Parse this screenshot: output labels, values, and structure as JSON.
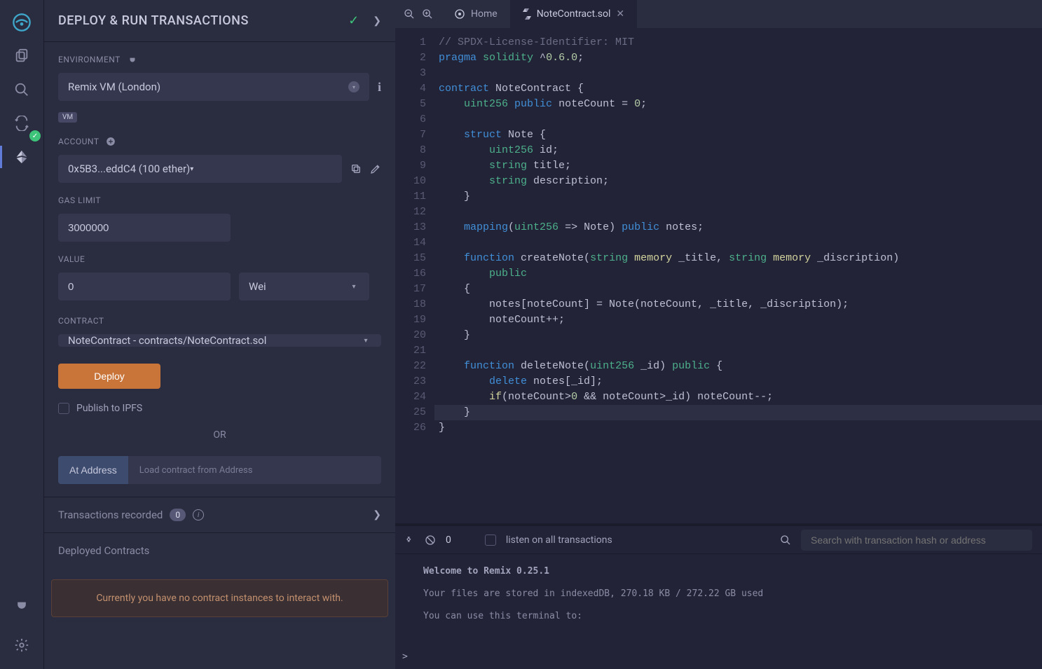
{
  "iconbar": {
    "items": [
      "logo",
      "files",
      "search",
      "compiler",
      "deploy",
      "plugin",
      "settings"
    ]
  },
  "panel": {
    "title": "DEPLOY & RUN TRANSACTIONS",
    "env_label": "ENVIRONMENT",
    "env_value": "Remix VM (London)",
    "env_badge": "VM",
    "account_label": "ACCOUNT",
    "account_value": "0x5B3...eddC4 (100 ether)",
    "gas_label": "GAS LIMIT",
    "gas_value": "3000000",
    "value_label": "VALUE",
    "value_value": "0",
    "value_unit": "Wei",
    "contract_label": "CONTRACT",
    "contract_value": "NoteContract - contracts/NoteContract.sol",
    "deploy_btn": "Deploy",
    "publish_ipfs": "Publish to IPFS",
    "or_text": "OR",
    "ataddress_btn": "At Address",
    "ataddress_ph": "Load contract from Address",
    "txrec_title": "Transactions recorded",
    "txrec_count": "0",
    "deployed_title": "Deployed Contracts",
    "no_contract_msg": "Currently you have no contract instances to interact with."
  },
  "tabs": {
    "home": "Home",
    "file": "NoteContract.sol"
  },
  "editor": {
    "lines": [
      {
        "n": 1,
        "segs": [
          {
            "t": "// SPDX-License-Identifier: MIT",
            "c": "tok-comment"
          }
        ]
      },
      {
        "n": 2,
        "segs": [
          {
            "t": "pragma",
            "c": "tok-keyword"
          },
          {
            "t": " "
          },
          {
            "t": "solidity",
            "c": "tok-keyword2"
          },
          {
            "t": " ^"
          },
          {
            "t": "0.6.0",
            "c": "tok-num"
          },
          {
            "t": ";"
          }
        ]
      },
      {
        "n": 3,
        "segs": [
          {
            "t": ""
          }
        ]
      },
      {
        "n": 4,
        "segs": [
          {
            "t": "contract",
            "c": "tok-keyword"
          },
          {
            "t": " NoteContract {"
          }
        ]
      },
      {
        "n": 5,
        "segs": [
          {
            "t": "    "
          },
          {
            "t": "uint256",
            "c": "tok-type"
          },
          {
            "t": " "
          },
          {
            "t": "public",
            "c": "tok-keyword"
          },
          {
            "t": " noteCount = "
          },
          {
            "t": "0",
            "c": "tok-num"
          },
          {
            "t": ";"
          }
        ]
      },
      {
        "n": 6,
        "segs": [
          {
            "t": ""
          }
        ]
      },
      {
        "n": 7,
        "segs": [
          {
            "t": "    "
          },
          {
            "t": "struct",
            "c": "tok-keyword"
          },
          {
            "t": " Note {"
          }
        ]
      },
      {
        "n": 8,
        "segs": [
          {
            "t": "        "
          },
          {
            "t": "uint256",
            "c": "tok-type"
          },
          {
            "t": " id;"
          }
        ]
      },
      {
        "n": 9,
        "segs": [
          {
            "t": "        "
          },
          {
            "t": "string",
            "c": "tok-type"
          },
          {
            "t": " title;"
          }
        ]
      },
      {
        "n": 10,
        "segs": [
          {
            "t": "        "
          },
          {
            "t": "string",
            "c": "tok-type"
          },
          {
            "t": " description;"
          }
        ]
      },
      {
        "n": 11,
        "segs": [
          {
            "t": "    }"
          }
        ]
      },
      {
        "n": 12,
        "segs": [
          {
            "t": ""
          }
        ]
      },
      {
        "n": 13,
        "segs": [
          {
            "t": "    "
          },
          {
            "t": "mapping",
            "c": "tok-keyword"
          },
          {
            "t": "("
          },
          {
            "t": "uint256",
            "c": "tok-type"
          },
          {
            "t": " => Note) "
          },
          {
            "t": "public",
            "c": "tok-keyword"
          },
          {
            "t": " notes;"
          }
        ]
      },
      {
        "n": 14,
        "segs": [
          {
            "t": ""
          }
        ]
      },
      {
        "n": 15,
        "segs": [
          {
            "t": "    "
          },
          {
            "t": "function",
            "c": "tok-keyword"
          },
          {
            "t": " createNote("
          },
          {
            "t": "string",
            "c": "tok-type"
          },
          {
            "t": " "
          },
          {
            "t": "memory",
            "c": "tok-op"
          },
          {
            "t": " _title, "
          },
          {
            "t": "string",
            "c": "tok-type"
          },
          {
            "t": " "
          },
          {
            "t": "memory",
            "c": "tok-op"
          },
          {
            "t": " _discription)"
          }
        ]
      },
      {
        "n": 16,
        "segs": [
          {
            "t": "        "
          },
          {
            "t": "public",
            "c": "tok-keyword2"
          }
        ]
      },
      {
        "n": 17,
        "segs": [
          {
            "t": "    {"
          }
        ]
      },
      {
        "n": 18,
        "segs": [
          {
            "t": "        notes[noteCount] = Note(noteCount, _title, _discription);"
          }
        ]
      },
      {
        "n": 19,
        "segs": [
          {
            "t": "        noteCount++;"
          }
        ]
      },
      {
        "n": 20,
        "segs": [
          {
            "t": "    }"
          }
        ]
      },
      {
        "n": 21,
        "segs": [
          {
            "t": ""
          }
        ]
      },
      {
        "n": 22,
        "segs": [
          {
            "t": "    "
          },
          {
            "t": "function",
            "c": "tok-keyword"
          },
          {
            "t": " deleteNote("
          },
          {
            "t": "uint256",
            "c": "tok-type"
          },
          {
            "t": " _id) "
          },
          {
            "t": "public",
            "c": "tok-keyword2"
          },
          {
            "t": " {"
          }
        ]
      },
      {
        "n": 23,
        "segs": [
          {
            "t": "        "
          },
          {
            "t": "delete",
            "c": "tok-keyword"
          },
          {
            "t": " notes[_id];"
          }
        ]
      },
      {
        "n": 24,
        "segs": [
          {
            "t": "        "
          },
          {
            "t": "if",
            "c": "tok-op"
          },
          {
            "t": "(noteCount>"
          },
          {
            "t": "0",
            "c": "tok-num"
          },
          {
            "t": " && noteCount>_id) noteCount--;"
          }
        ]
      },
      {
        "n": 25,
        "segs": [
          {
            "t": "    }"
          }
        ],
        "current": true
      },
      {
        "n": 26,
        "segs": [
          {
            "t": "}"
          }
        ]
      }
    ]
  },
  "terminal": {
    "pending": "0",
    "listen_label": "listen on all transactions",
    "search_ph": "Search with transaction hash or address",
    "welcome": "Welcome to Remix 0.25.1",
    "storage": "Your files are stored in indexedDB, 270.18 KB / 272.22 GB used",
    "usage": "You can use this terminal to:"
  }
}
